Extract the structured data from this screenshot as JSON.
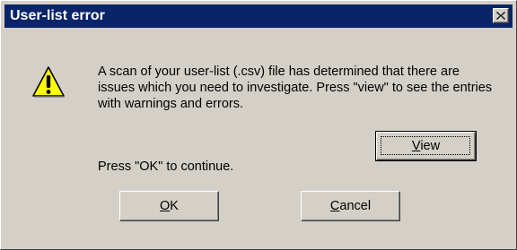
{
  "window": {
    "title": "User-list error"
  },
  "icons": {
    "titlebar_close": "close-icon",
    "message_icon": "warning-icon"
  },
  "message": {
    "body": "A scan of your user-list (.csv) file has determined that there are issues which you need to investigate.  Press \"view\" to see the entries with warnings and errors.",
    "continue": "Press \"OK\" to continue."
  },
  "buttons": {
    "view": {
      "mnemonic": "V",
      "rest": "iew"
    },
    "ok": {
      "mnemonic": "O",
      "rest": "K"
    },
    "cancel": {
      "mnemonic": "C",
      "rest": "ancel"
    }
  },
  "colors": {
    "titlebar": "#0a246a",
    "dialog_face": "#d4d0c8",
    "warning_fill": "#ffff00"
  }
}
